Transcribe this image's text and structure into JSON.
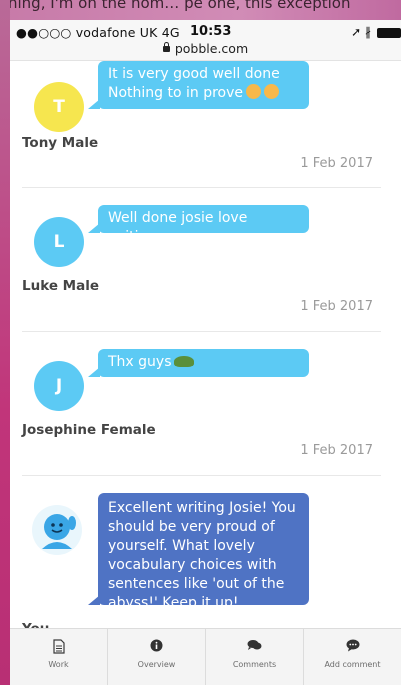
{
  "background_peek_text": "ning, I'm on the hom… pe one, this exception",
  "status_bar": {
    "carrier": "●●○○○ vodafone UK  4G",
    "time": "10:53",
    "right": "➚ ∦",
    "url": "pobble.com"
  },
  "comments": [
    {
      "initial": "T",
      "avatar_color": "#f6e64f",
      "message": "It is very good well done Nothing to in prove",
      "author": "Tony Male",
      "date": "1 Feb 2017"
    },
    {
      "initial": "L",
      "avatar_color": "#5ccaf4",
      "message": "Well done josie love writing",
      "author": "Luke Male",
      "date": "1 Feb 2017"
    },
    {
      "initial": "J",
      "avatar_color": "#5ccaf4",
      "message": "Thx guys",
      "author": "Josephine Female",
      "date": "1 Feb 2017"
    },
    {
      "message": "Excellent writing Josie! You should be very proud of yourself. What lovely vocabulary choices with sentences like 'out of the abyss!' Keep it up!",
      "author": "You"
    }
  ],
  "colors": {
    "bubble_blue": "#5ccaf4",
    "bubble_purple": "#4f73c4"
  },
  "tabs": [
    {
      "label": "Work",
      "icon": "document-icon"
    },
    {
      "label": "Overview",
      "icon": "info-icon"
    },
    {
      "label": "Comments",
      "icon": "chat-bubbles-icon"
    },
    {
      "label": "Add comment",
      "icon": "add-comment-icon"
    }
  ]
}
